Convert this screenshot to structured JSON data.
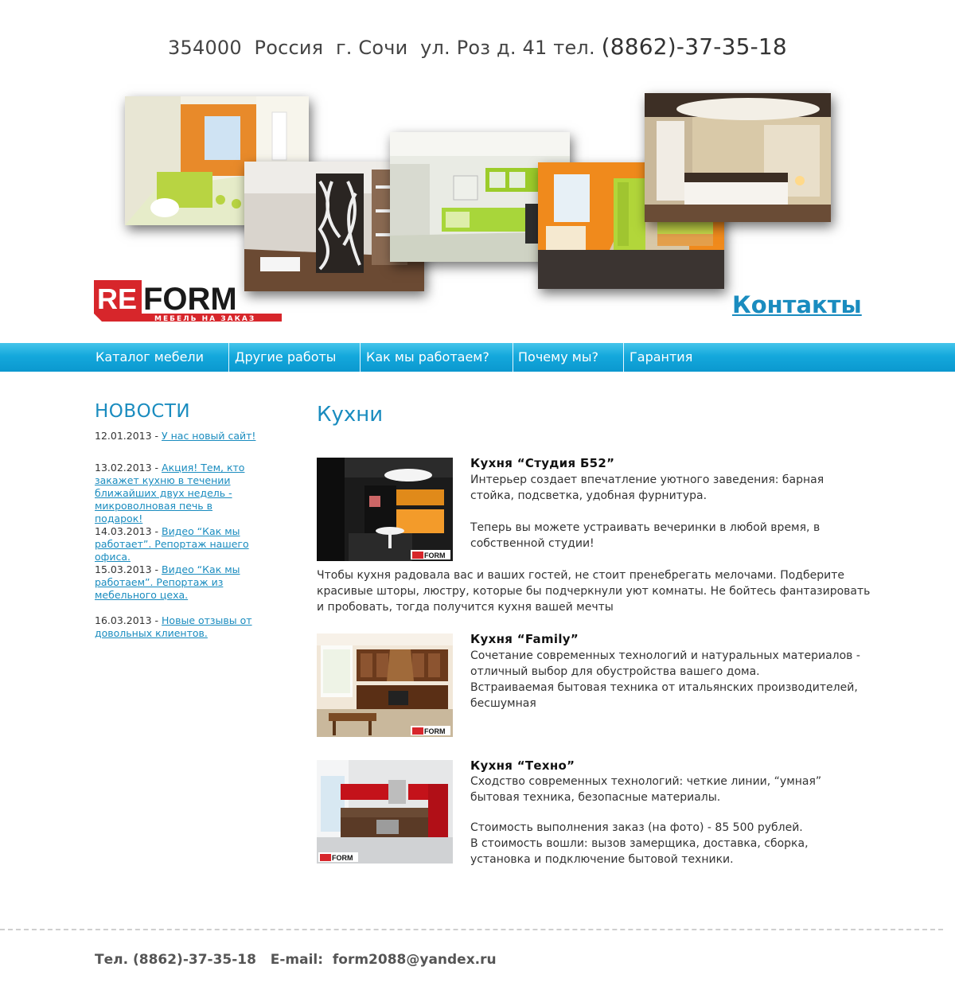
{
  "header": {
    "address": "354000  Россия  г. Сочи  ул. Роз д. 41 тел. ",
    "phone": "(8862)-37-35-18"
  },
  "logo": {
    "brand_re": "RE",
    "brand_form": "FORM",
    "tagline": "МЕБЕЛЬ НА ЗАКАЗ"
  },
  "contacts_link": "Контакты",
  "nav": [
    {
      "label": "Каталог мебели"
    },
    {
      "label": "Другие работы"
    },
    {
      "label": "Как мы работаем?"
    },
    {
      "label": "Почему мы?"
    },
    {
      "label": "Гарантия"
    }
  ],
  "news": {
    "title": "НОВОСТИ",
    "items": [
      {
        "date": "12.01.2013 - ",
        "link": "У нас новый сайт!"
      },
      {
        "date": "13.02.2013 - ",
        "link": "Акция! Тем, кто закажет кухню в течении ближайших двух недель - микроволновая печь в подарок!"
      },
      {
        "date": "14.03.2013 - ",
        "link": "Видео “Как мы работает”. Репортаж нашего офиса."
      },
      {
        "date": "15.03.2013 - ",
        "link": "Видео “Как мы работаем”. Репортаж из мебельного цеха."
      },
      {
        "date": "16.03.2013 - ",
        "link": "Новые отзывы от довольных клиентов."
      }
    ]
  },
  "main": {
    "title": "Кухни",
    "kitchens": [
      {
        "title": "Кухня “Студия Б52”",
        "text1": "Интерьер создает впечатление уютного заведения: барная стойка, подсветка, удобная фурнитура.",
        "text2": "Теперь вы можете устраивать вечеринки в любой время, в собственной студии!",
        "text3": "Чтобы кухня радовала вас и ваших гостей, не стоит пренебрегать мелочами. Подберите красивые шторы, люстру, которые бы подчеркнули уют комнаты. Не бойтесь фантазировать и пробовать, тогда получится кухня вашей мечты"
      },
      {
        "title": "Кухня “Family”",
        "text1": "Сочетание современных технологий и натуральных материалов - отличный выбор для обустройства вашего дома.",
        "text2": "Встраиваемая бытовая техника от итальянских производителей, бесшумная"
      },
      {
        "title": "Кухня “Техно”",
        "text1": "Сходство современных технологий: четкие линии, “умная” бытовая  техника, безопасные материалы.",
        "text2": "Стоимость выполнения заказ (на фото) - 85 500 рублей.",
        "text3": "В стоимость вошли: вызов замерщика, доставка, сборка, установка и подключение бытовой техники."
      }
    ]
  },
  "footer": {
    "phone_label": "Тел. ",
    "phone": "(8862)-37-35-18",
    "email_label": "   E-mail:  ",
    "email": "form2088@yandex.ru"
  },
  "colors": {
    "accent": "#1a8cbf",
    "nav": "#14a8dc",
    "brand_red": "#d7262b"
  }
}
